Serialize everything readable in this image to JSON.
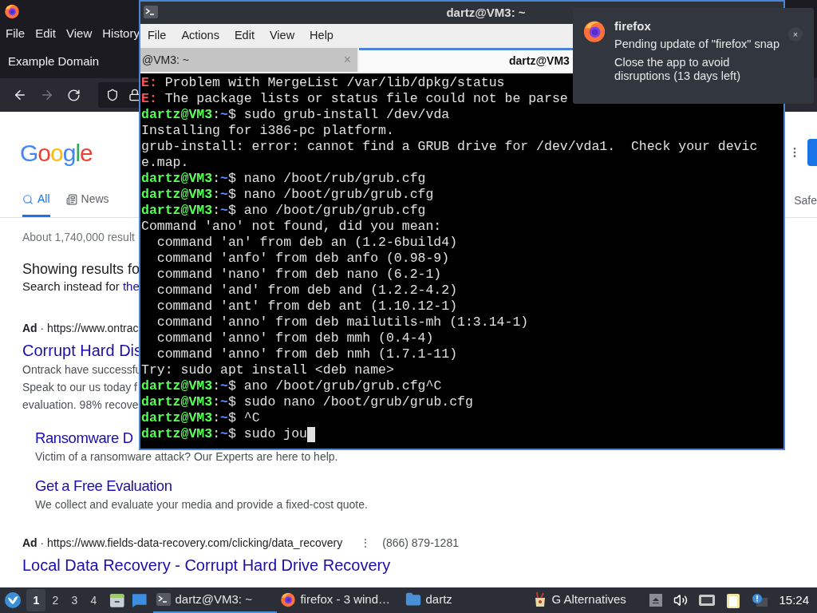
{
  "browser": {
    "menu": [
      "File",
      "Edit",
      "View",
      "History"
    ],
    "tab": {
      "title": "Example Domain"
    },
    "nav": {
      "back": {
        "disabled": false
      },
      "forward": {
        "disabled": true
      }
    },
    "page": {
      "logo": "Google",
      "search_tabs": [
        {
          "label": "All",
          "kind": "search",
          "selected": true
        },
        {
          "label": "News",
          "kind": "news",
          "selected": false
        }
      ],
      "right_tab": "Safe",
      "result_stats": "About 1,740,000 result",
      "correction": {
        "heading": "Showing results fo",
        "prefix": "Search instead for ",
        "link": "the"
      },
      "ads": [
        {
          "source": "**Ad** · https://www.ontrac",
          "title": "Corrupt Hard Dis",
          "lines": [
            "Ontrack have successfu",
            "Speak to our us today f",
            "evaluation. 98% recove"
          ],
          "sitelinks": [
            {
              "title": "Ransomware D",
              "text": "Victim of a ransomware attack? Our Experts are here to help."
            },
            {
              "title": "Get a Free Evaluation",
              "text": "We collect and evaluate your media and provide a fixed-cost quote."
            }
          ]
        },
        {
          "source": "**Ad** · https://www.fields-data-recovery.com/clicking/data_recovery",
          "menu": "⋮",
          "phone": "(866) 879-1281",
          "title": "Local Data Recovery - Corrupt Hard Drive Recovery"
        }
      ]
    }
  },
  "terminal": {
    "title": "dartz@VM3: ~",
    "menu": [
      "File",
      "Actions",
      "Edit",
      "View",
      "Help"
    ],
    "tabs": [
      {
        "label": "@VM3: ~",
        "selected": false,
        "close": "×"
      },
      {
        "label": "dartz@VM3",
        "selected": true
      }
    ],
    "lines": [
      {
        "kind": "error",
        "tag": "E:",
        "text": " Problem with MergeList /var/lib/dpkg/status"
      },
      {
        "kind": "error",
        "tag": "E:",
        "text": " The package lists or status file could not be parse"
      },
      {
        "kind": "prompt",
        "user": "dartz@VM3",
        "separator": ":",
        "path": "~",
        "command": "$ sudo grub-install /dev/vda"
      },
      {
        "kind": "plain",
        "text": "Installing for i386-pc platform."
      },
      {
        "kind": "plain",
        "text": "grub-install: error: cannot find a GRUB drive for /dev/vda1.  Check your devic"
      },
      {
        "kind": "plain",
        "text": "e.map."
      },
      {
        "kind": "prompt",
        "user": "dartz@VM3",
        "separator": ":",
        "path": "~",
        "command": "$ nano /boot/rub/grub.cfg"
      },
      {
        "kind": "prompt",
        "user": "dartz@VM3",
        "separator": ":",
        "path": "~",
        "command": "$ nano /boot/grub/grub.cfg"
      },
      {
        "kind": "prompt",
        "user": "dartz@VM3",
        "separator": ":",
        "path": "~",
        "command": "$ ano /boot/grub/grub.cfg"
      },
      {
        "kind": "plain",
        "text": "Command 'ano' not found, did you mean:"
      },
      {
        "kind": "plain",
        "text": "  command 'an' from deb an (1.2-6build4)"
      },
      {
        "kind": "plain",
        "text": "  command 'anfo' from deb anfo (0.98-9)"
      },
      {
        "kind": "plain",
        "text": "  command 'nano' from deb nano (6.2-1)"
      },
      {
        "kind": "plain",
        "text": "  command 'and' from deb and (1.2.2-4.2)"
      },
      {
        "kind": "plain",
        "text": "  command 'ant' from deb ant (1.10.12-1)"
      },
      {
        "kind": "plain",
        "text": "  command 'anno' from deb mailutils-mh (1:3.14-1)"
      },
      {
        "kind": "plain",
        "text": "  command 'anno' from deb mmh (0.4-4)"
      },
      {
        "kind": "plain",
        "text": "  command 'anno' from deb nmh (1.7.1-11)"
      },
      {
        "kind": "plain",
        "text": "Try: sudo apt install <deb name>"
      },
      {
        "kind": "prompt",
        "user": "dartz@VM3",
        "separator": ":",
        "path": "~",
        "command": "$ ano /boot/grub/grub.cfg^C"
      },
      {
        "kind": "prompt",
        "user": "dartz@VM3",
        "separator": ":",
        "path": "~",
        "command": "$ sudo nano /boot/grub/grub.cfg"
      },
      {
        "kind": "prompt",
        "user": "dartz@VM3",
        "separator": ":",
        "path": "~",
        "command": "$ ^C"
      },
      {
        "kind": "prompt",
        "user": "dartz@VM3",
        "separator": ":",
        "path": "~",
        "command": "$ sudo jou"
      }
    ]
  },
  "notification": {
    "app": "firefox",
    "lines": [
      "Pending update of \"firefox\" snap",
      "Close the app to avoid disruptions (13 days left)"
    ],
    "close": "×"
  },
  "taskbar": {
    "workspaces": [
      {
        "label": "1",
        "selected": true
      },
      {
        "label": "2",
        "selected": false
      },
      {
        "label": "3",
        "selected": false
      },
      {
        "label": "4",
        "selected": false
      }
    ],
    "tasks": [
      {
        "label": "dartz@VM3: ~",
        "kind": "terminal",
        "selected": true
      },
      {
        "label": "firefox - 3 wind…",
        "kind": "firefox",
        "selected": false
      },
      {
        "label": "dartz",
        "kind": "folder",
        "selected": false
      },
      {
        "label": "G Alternatives",
        "kind": "app",
        "selected": false
      }
    ],
    "clock": "15:24"
  }
}
